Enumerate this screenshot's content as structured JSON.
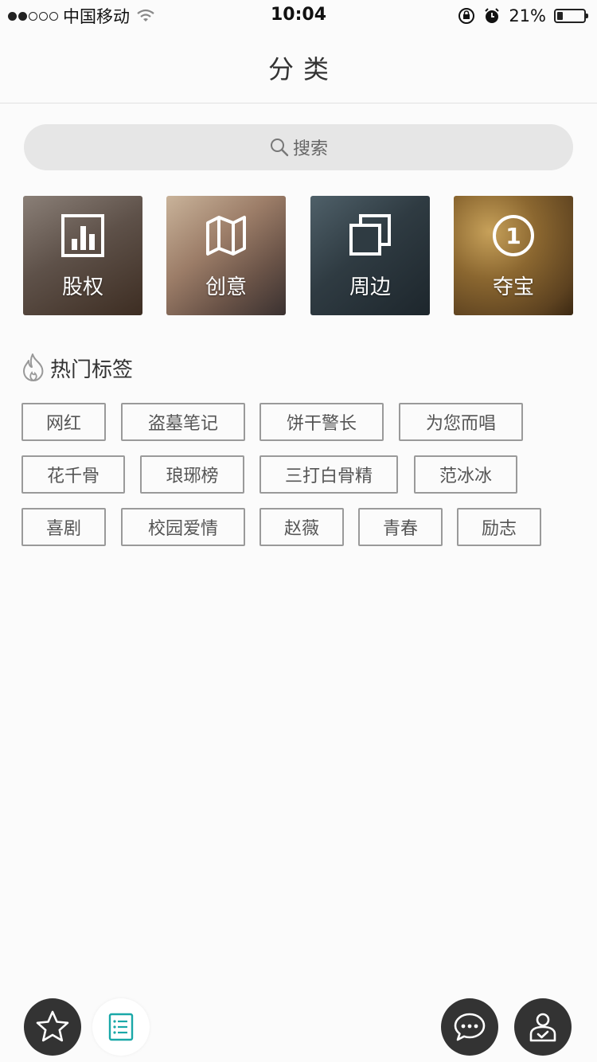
{
  "status_bar": {
    "carrier": "中国移动",
    "time": "10:04",
    "battery_percent": "21%",
    "battery_level": 0.21
  },
  "nav": {
    "title": "分类"
  },
  "search": {
    "label": "搜索",
    "icon": "search-icon"
  },
  "categories": [
    {
      "label": "股权",
      "icon": "bar-chart-icon"
    },
    {
      "label": "创意",
      "icon": "map-icon"
    },
    {
      "label": "周边",
      "icon": "copy-icon"
    },
    {
      "label": "夺宝",
      "icon": "number-one-icon",
      "number": "1"
    }
  ],
  "hot_tags": {
    "title": "热门标签",
    "icon": "fire-icon",
    "rows": [
      [
        "网红",
        "盗墓笔记",
        "饼干警长",
        "为您而唱"
      ],
      [
        "花千骨",
        "琅琊榜",
        "三打白骨精",
        "范冰冰"
      ],
      [
        "喜剧",
        "校园爱情",
        "赵薇",
        "青春",
        "励志"
      ]
    ]
  },
  "bottom_buttons": [
    {
      "name": "favorites",
      "icon": "star-icon"
    },
    {
      "name": "list",
      "icon": "list-icon",
      "accent": "#1aa8a8"
    },
    {
      "name": "messages",
      "icon": "chat-bubble-icon"
    },
    {
      "name": "profile",
      "icon": "user-check-icon"
    }
  ]
}
